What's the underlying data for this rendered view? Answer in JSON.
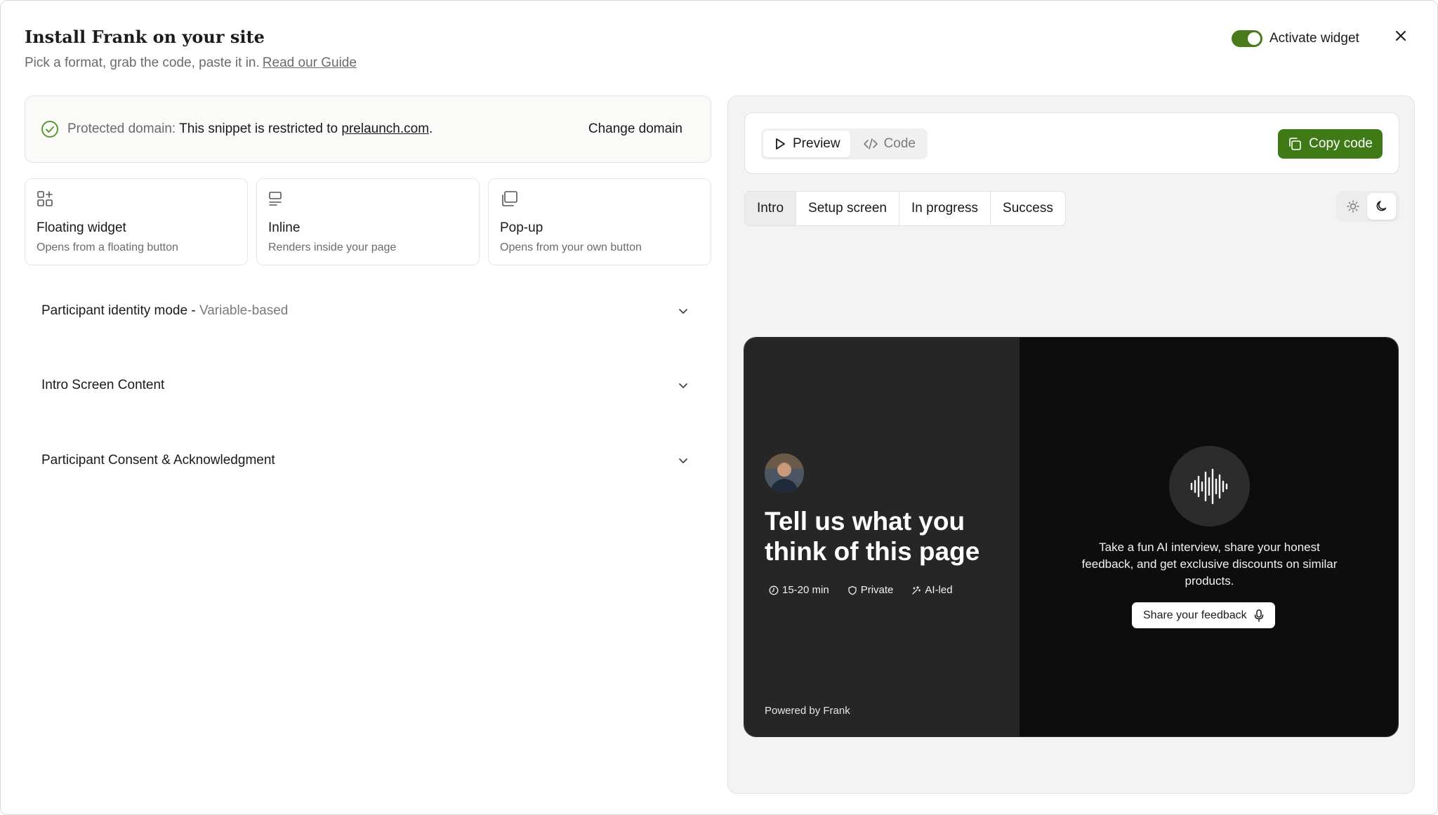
{
  "header": {
    "title": "Install Frank on your site",
    "subtitle": "Pick a format, grab the code, paste it in.",
    "guide_link": "Read our Guide",
    "activate_label": "Activate widget",
    "activate_on": true
  },
  "domain": {
    "label": "Protected domain:",
    "text": "This snippet is restricted to",
    "domain": "prelaunch.com",
    "period": ".",
    "change_label": "Change domain"
  },
  "formats": [
    {
      "name": "Floating widget",
      "desc": "Opens from a floating button",
      "icon": "grid-plus-icon"
    },
    {
      "name": "Inline",
      "desc": "Renders inside your page",
      "icon": "inline-layout-icon"
    },
    {
      "name": "Pop-up",
      "desc": "Opens from your own button",
      "icon": "popup-stack-icon"
    }
  ],
  "accordions": [
    {
      "label": "Participant identity mode - ",
      "value": "Variable-based"
    },
    {
      "label": "Intro Screen Content",
      "value": ""
    },
    {
      "label": "Participant Consent & Acknowledgment",
      "value": ""
    }
  ],
  "toolbar": {
    "preview_label": "Preview",
    "code_label": "Code",
    "copy_label": "Copy code"
  },
  "tabs": [
    "Intro",
    "Setup screen",
    "In progress",
    "Success"
  ],
  "preview": {
    "title": "Tell us what you think of this page",
    "meta": [
      {
        "icon": "clock-icon",
        "label": "15-20 min"
      },
      {
        "icon": "shield-icon",
        "label": "Private"
      },
      {
        "icon": "sparkle-icon",
        "label": "AI-led"
      }
    ],
    "powered": "Powered by Frank",
    "description": "Take a fun AI interview, share your honest feedback, and get exclusive discounts on similar products.",
    "button_label": "Share your feedback"
  },
  "colors": {
    "accent": "#3f7a17",
    "preview_left": "#262626",
    "preview_right": "#0d0d0d"
  }
}
